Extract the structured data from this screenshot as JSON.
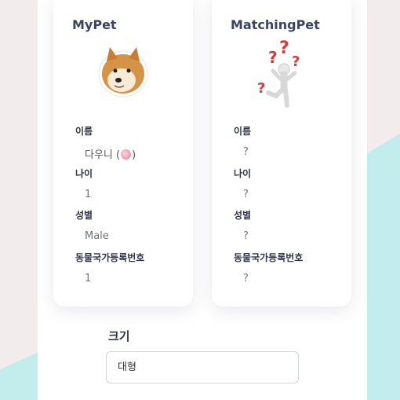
{
  "mypet": {
    "title": "MyPet",
    "name_label": "이름",
    "name_value": "다우니 (",
    "name_suffix": ")",
    "age_label": "나이",
    "age_value": "1",
    "gender_label": "성별",
    "gender_value": "Male",
    "reg_label": "동물국가등록번호",
    "reg_value": "1"
  },
  "matching": {
    "title": "MatchingPet",
    "name_label": "이름",
    "name_value": "?",
    "age_label": "나이",
    "age_value": "?",
    "gender_label": "성별",
    "gender_value": "?",
    "reg_label": "동물국가등록번호",
    "reg_value": "?"
  },
  "size": {
    "label": "크기",
    "value": "대형"
  },
  "colors": {
    "background": "#f3ecec",
    "accent_teal": "#bfeaea",
    "title": "#3a4563"
  }
}
